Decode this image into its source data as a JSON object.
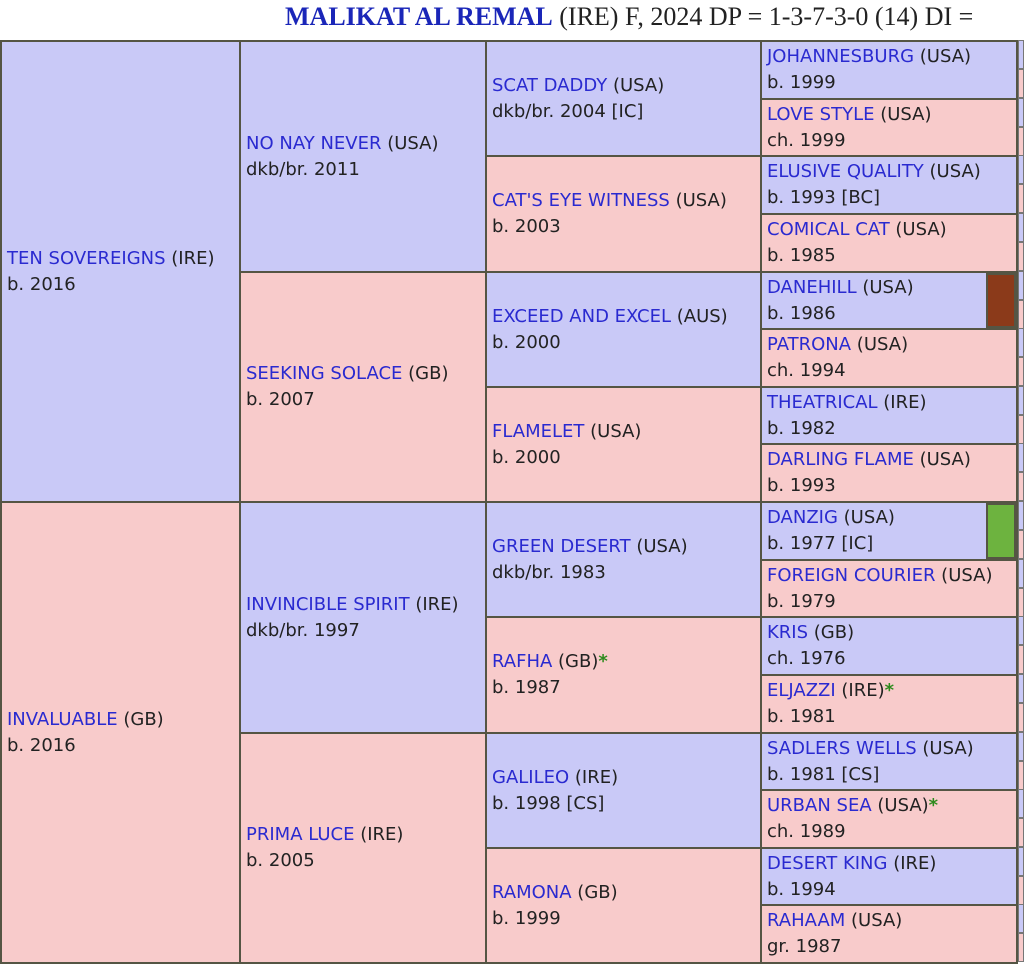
{
  "header": {
    "horse_name": "MALIKAT AL REMAL",
    "rest": " (IRE) F, 2024 DP = 1-3-7-3-0 (14) DI ="
  },
  "pedigree": {
    "col1": [
      {
        "name": "TEN SOVEREIGNS",
        "country": "(IRE)",
        "info": "b. 2016",
        "sex": "m"
      },
      {
        "name": "INVALUABLE",
        "country": "(GB)",
        "info": "b. 2016",
        "sex": "f"
      }
    ],
    "col2": [
      {
        "name": "NO NAY NEVER",
        "country": "(USA)",
        "info": "dkb/br. 2011",
        "sex": "m"
      },
      {
        "name": "SEEKING SOLACE",
        "country": "(GB)",
        "info": "b. 2007",
        "sex": "f"
      },
      {
        "name": "INVINCIBLE SPIRIT",
        "country": "(IRE)",
        "info": "dkb/br. 1997",
        "sex": "m"
      },
      {
        "name": "PRIMA LUCE",
        "country": "(IRE)",
        "info": "b. 2005",
        "sex": "f"
      }
    ],
    "col3": [
      {
        "name": "SCAT DADDY",
        "country": "(USA)",
        "info": "dkb/br. 2004 [IC]",
        "sex": "m"
      },
      {
        "name": "CAT'S EYE WITNESS",
        "country": "(USA)",
        "info": "b. 2003",
        "sex": "f"
      },
      {
        "name": "EXCEED AND EXCEL",
        "country": "(AUS)",
        "info": "b. 2000",
        "sex": "m"
      },
      {
        "name": "FLAMELET",
        "country": "(USA)",
        "info": "b. 2000",
        "sex": "f"
      },
      {
        "name": "GREEN DESERT",
        "country": "(USA)",
        "info": "dkb/br. 1983",
        "sex": "m"
      },
      {
        "name": "RAFHA",
        "country": "(GB)",
        "info": "b. 1987",
        "sex": "f",
        "star": "*"
      },
      {
        "name": "GALILEO",
        "country": "(IRE)",
        "info": "b. 1998 [CS]",
        "sex": "m"
      },
      {
        "name": "RAMONA",
        "country": "(GB)",
        "info": "b. 1999",
        "sex": "f"
      }
    ],
    "col4": [
      {
        "name": "JOHANNESBURG",
        "country": "(USA)",
        "info": "b. 1999",
        "sex": "m"
      },
      {
        "name": "LOVE STYLE",
        "country": "(USA)",
        "info": "ch. 1999",
        "sex": "f"
      },
      {
        "name": "ELUSIVE QUALITY",
        "country": "(USA)",
        "info": "b. 1993 [BC]",
        "sex": "m"
      },
      {
        "name": "COMICAL CAT",
        "country": "(USA)",
        "info": "b. 1985",
        "sex": "f"
      },
      {
        "name": "DANEHILL",
        "country": "(USA)",
        "info": "b. 1986",
        "sex": "m",
        "swatch": "#8b3a1a"
      },
      {
        "name": "PATRONA",
        "country": "(USA)",
        "info": "ch. 1994",
        "sex": "f"
      },
      {
        "name": "THEATRICAL",
        "country": "(IRE)",
        "info": "b. 1982",
        "sex": "m"
      },
      {
        "name": "DARLING FLAME",
        "country": "(USA)",
        "info": "b. 1993",
        "sex": "f"
      },
      {
        "name": "DANZIG",
        "country": "(USA)",
        "info": "b. 1977 [IC]",
        "sex": "m",
        "swatch": "#6db33f"
      },
      {
        "name": "FOREIGN COURIER",
        "country": "(USA)",
        "info": "b. 1979",
        "sex": "f"
      },
      {
        "name": "KRIS",
        "country": "(GB)",
        "info": "ch. 1976",
        "sex": "m"
      },
      {
        "name": "ELJAZZI",
        "country": "(IRE)",
        "info": "b. 1981",
        "sex": "f",
        "star": "*"
      },
      {
        "name": "SADLERS WELLS",
        "country": "(USA)",
        "info": "b. 1981 [CS]",
        "sex": "m"
      },
      {
        "name": "URBAN SEA",
        "country": "(USA)",
        "info": "ch. 1989",
        "sex": "f",
        "star": "*"
      },
      {
        "name": "DESERT KING",
        "country": "(IRE)",
        "info": "b. 1994",
        "sex": "m"
      },
      {
        "name": "RAHAAM",
        "country": "(USA)",
        "info": "gr. 1987",
        "sex": "f"
      }
    ]
  },
  "colors": {
    "male_bg": "#c9c9f7",
    "female_bg": "#f8cbcb",
    "link": "#2a2ad0",
    "title": "#1a26b8",
    "dosage_star": "#2e8b1e"
  }
}
